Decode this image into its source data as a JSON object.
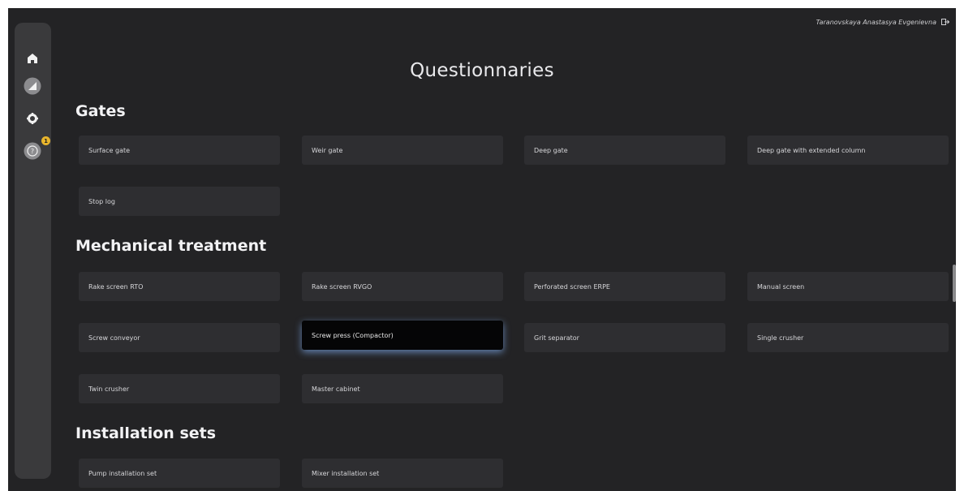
{
  "header": {
    "user_name": "Taranovskaya Anastasya Evgenievna",
    "logout_icon": "logout-icon"
  },
  "sidebar": {
    "items": [
      {
        "icon": "home-icon"
      },
      {
        "icon": "chart-icon"
      },
      {
        "icon": "gear-icon"
      },
      {
        "icon": "help-icon",
        "badge": "1"
      }
    ]
  },
  "main": {
    "title": "Questionnaries",
    "sections": [
      {
        "title": "Gates",
        "items": [
          "Surface gate",
          "Weir gate",
          "Deep gate",
          "Deep gate with extended column",
          "Stop log"
        ]
      },
      {
        "title": "Mechanical treatment",
        "items": [
          "Rake screen RTO",
          "Rake screen RVGO",
          "Perforated screen ERPE",
          "Manual screen",
          "Screw conveyor",
          "Screw press (Compactor)",
          "Grit separator",
          "Single crusher",
          "Twin crusher",
          "Master cabinet"
        ]
      },
      {
        "title": "Installation sets",
        "items": [
          "Pump installation set",
          "Mixer installation set"
        ]
      }
    ]
  },
  "colors": {
    "background": "#232325",
    "card": "#2e2e31",
    "selected_card": "#050506",
    "badge": "#e9b52c"
  }
}
